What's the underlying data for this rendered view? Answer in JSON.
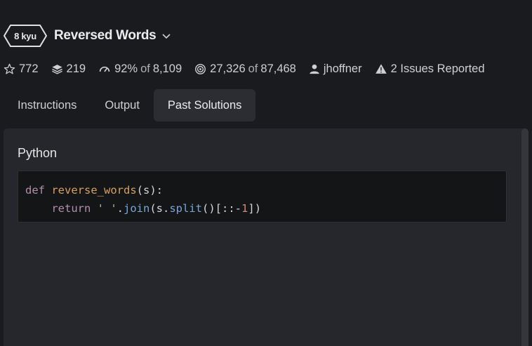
{
  "kata": {
    "rank_label": "8 kyu",
    "title": "Reversed Words",
    "check_icon": "chevron-down-icon"
  },
  "stats": {
    "stars": "772",
    "collections": "219",
    "satisfaction": "92%",
    "satisfaction_of": "of",
    "satisfaction_votes": "8,109",
    "completed": "27,326",
    "completed_of": "of",
    "attempted": "87,468",
    "author": "jhoffner",
    "issues": "2 Issues Reported"
  },
  "tabs": [
    {
      "label": "Instructions",
      "active": false
    },
    {
      "label": "Output",
      "active": false
    },
    {
      "label": "Past Solutions",
      "active": true
    }
  ],
  "solution": {
    "language": "Python",
    "code": {
      "line1": {
        "kw": "def",
        "fn": "reverse_words",
        "rest": "(s):"
      },
      "line2": {
        "indent": "    ",
        "kw": "return",
        "sp": " ",
        "str": "' '",
        "dot": ".",
        "meth1": "join",
        "mid": "(s.",
        "meth2": "split",
        "tail1": "()[::-",
        "num": "1",
        "tail2": "])"
      }
    }
  },
  "colors": {
    "background": "#1a1b1f",
    "panel": "#26272c",
    "code_bg": "#141517",
    "keyword": "#b48ead",
    "function": "#d7a05c",
    "string": "#a3be8c",
    "method": "#79a6d8",
    "number": "#d08770"
  }
}
